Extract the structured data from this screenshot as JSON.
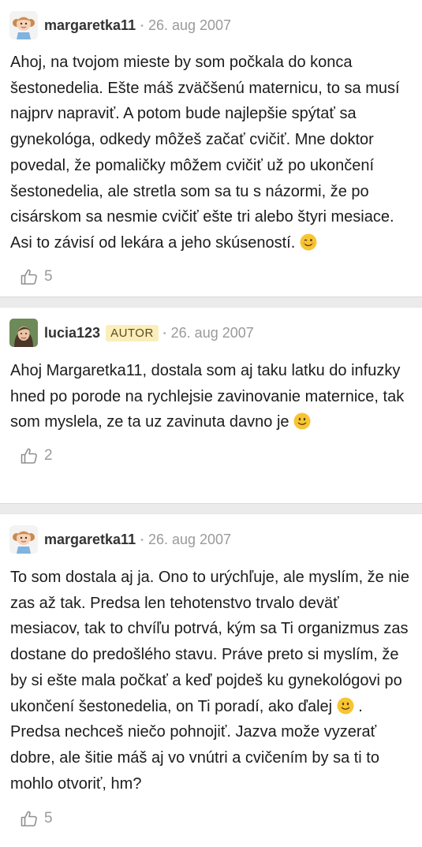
{
  "posts": [
    {
      "username": "margaretka11",
      "badge": "",
      "date": "26. aug 2007",
      "text_before": "Ahoj, na tvojom mieste by som počkala do konca šestonedelia. Ešte máš zväčšenú maternicu, to sa musí najprv napraviť. A potom bude najlepšie spýtať sa gynekológa, odkedy môžeš začať cvičiť. Mne doktor povedal, že pomaličky môžem cvičiť už po ukončení šestonedelia, ale stretla som sa tu s názormi, že po cisárskom sa nesmie cvičiť ešte tri alebo štyri mesiace. Asi to závisí od lekára a jeho skúseností.",
      "emoji": "wink-emoji",
      "likes": "5"
    },
    {
      "username": "lucia123",
      "badge": "AUTOR",
      "date": "26. aug 2007",
      "text_before": "Ahoj Margaretka11, dostala som aj taku latku do infuzky hned po porode na rychlejsie zavinovanie maternice, tak som myslela, ze ta uz zavinuta davno je",
      "emoji": "smile-emoji",
      "likes": "2"
    },
    {
      "username": "margaretka11",
      "badge": "",
      "date": "26. aug 2007",
      "text_before": "To som dostala aj ja. Ono to urýchľuje, ale myslím, že nie zas až tak. Predsa len tehotenstvo trvalo deväť mesiacov, tak to chvíľu potrvá, kým sa Ti organizmus zas dostane do predošlého stavu. Práve preto si myslím, že by si ešte mala počkať a keď pojdeš ku gynekológovi po ukončení šestonedelia, on Ti poradí, ako ďalej",
      "emoji": "smile-emoji",
      "text_after": " . Predsa nechceš niečo pohnojiť. Jazva može vyzerať dobre, ale šitie máš aj vo vnútri a cvičením by sa ti to mohlo otvoriť, hm?",
      "likes": "5"
    }
  ],
  "colors": {
    "divider": "#ebebeb",
    "badge_bg": "#fbeebb",
    "muted": "#9a9a9a"
  }
}
